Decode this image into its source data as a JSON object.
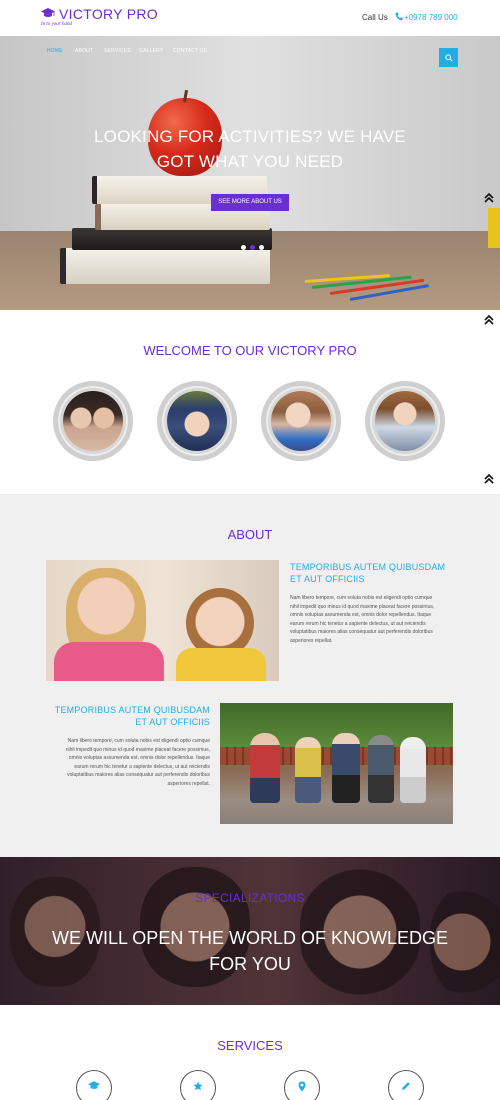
{
  "header": {
    "logo": "VICTORY PRO",
    "tagline": "In to your hand",
    "call_label": "Call Us",
    "phone": "+0978 789 000"
  },
  "nav": {
    "items": [
      "HOME",
      "ABOUT",
      "SERVICES",
      "GALLERY",
      "CONTACT US"
    ],
    "active": "HOME"
  },
  "hero": {
    "line1": "LOOKING FOR ACTIVITIES? WE HAVE",
    "line2": "GOT WHAT YOU NEED",
    "button": "SEE MORE ABOUT US",
    "active_slide": 2,
    "slide_count": 3
  },
  "welcome": {
    "title": "WELCOME TO OUR VICTORY PRO"
  },
  "about": {
    "title": "ABOUT",
    "block1": {
      "heading_1": "TEMPORIBUS AUTEM QUIBUSDAM",
      "heading_2": "ET AUT OFFICIIS",
      "body_lines": [
        "Nam libero tempore, cum soluta nobis est eligendi optio cumque",
        "nihil impedit quo minus id quod maxime placeat facere possimus,",
        "omnis voluptas assumenda est, omnis dolor repellendus. Itaque",
        "earum rerum hic tenetur a sapiente delectus, ut aut reiciendis",
        "voluptatibus maiores alias consequatur aut perferendis doloribus",
        "asperiores repellat."
      ]
    },
    "block2": {
      "heading_1": "TEMPORIBUS AUTEM QUIBUSDAM",
      "heading_2": "ET AUT OFFICIIS",
      "body_lines": [
        "Nam libero tempore, cum soluta nobis est eligendi optio cumque",
        "nihil impedit quo minus id quod maxime placeat facere possimus,",
        "omnis voluptas assumenda est, omnis dolor repellendus. Itaque",
        "earum rerum hic tenetur a sapiente delectus, ut aut reiciendis",
        "voluptatibus maiores alias consequatur aut perferendis doloribus",
        "asperiores repellat."
      ]
    }
  },
  "specializations": {
    "subtitle": "SPECIALIZATIONS",
    "line1": "WE WILL OPEN THE WORLD OF KNOWLEDGE",
    "line2": "FOR YOU"
  },
  "services": {
    "title": "SERVICES",
    "icons": [
      "graduation-cap-icon",
      "star-icon",
      "map-marker-icon",
      "pencil-icon"
    ]
  },
  "colors": {
    "brand_purple": "#6a2fd0",
    "accent_blue": "#21aee5"
  }
}
